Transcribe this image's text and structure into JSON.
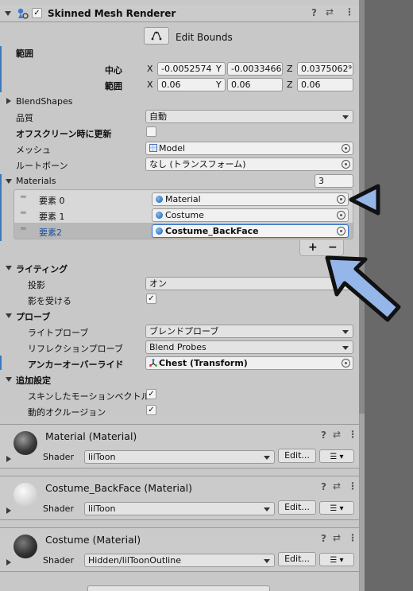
{
  "component": {
    "title": "Skinned Mesh Renderer",
    "icon": "skinned-mesh-icon",
    "enabled": true
  },
  "edit_bounds": {
    "label": "Edit Bounds"
  },
  "bounds": {
    "label": "範囲",
    "center_label": "中心",
    "center": {
      "x": "-0.0052574",
      "y": "-0.0033466",
      "z": "0.0375062⁹"
    },
    "extent_label": "範囲",
    "extent": {
      "x": "0.06",
      "y": "0.06",
      "z": "0.06"
    },
    "axis_x": "X",
    "axis_y": "Y",
    "axis_z": "Z"
  },
  "blendshapes": {
    "label": "BlendShapes"
  },
  "quality": {
    "label": "品質",
    "value": "自動"
  },
  "offscreen": {
    "label": "オフスクリーン時に更新",
    "checked": false
  },
  "mesh": {
    "label": "メッシュ",
    "value": "Model"
  },
  "root_bone": {
    "label": "ルートボーン",
    "value": "なし (トランスフォーム)"
  },
  "materials": {
    "label": "Materials",
    "count": "3",
    "items": [
      {
        "label": "要素 0",
        "value": "Material"
      },
      {
        "label": "要素 1",
        "value": "Costume"
      },
      {
        "label": "要素2",
        "value": "Costume_BackFace"
      }
    ],
    "add": "+",
    "remove": "−"
  },
  "lighting": {
    "label": "ライティング",
    "cast_shadows_label": "投影",
    "cast_shadows_value": "オン",
    "receive_shadows_label": "影を受ける",
    "receive_shadows": true
  },
  "probes": {
    "label": "プローブ",
    "light_probe_label": "ライトプローブ",
    "light_probe_value": "ブレンドプローブ",
    "reflection_label": "リフレクションプローブ",
    "reflection_value": "Blend Probes",
    "anchor_label": "アンカーオーバーライド",
    "anchor_value": "Chest (Transform)"
  },
  "additional": {
    "label": "追加設定",
    "motion_vectors_label": "スキンしたモーションベクトル",
    "motion_vectors": true,
    "occlusion_label": "動的オクルージョン",
    "occlusion": true
  },
  "material_blocks": [
    {
      "title": "Material (Material)",
      "shader_label": "Shader",
      "shader": "lilToon",
      "edit": "Edit...",
      "preview": "dark"
    },
    {
      "title": "Costume_BackFace (Material)",
      "shader_label": "Shader",
      "shader": "lilToon",
      "edit": "Edit...",
      "preview": "light"
    },
    {
      "title": "Costume (Material)",
      "shader_label": "Shader",
      "shader": "Hidden/lilToonOutline",
      "edit": "Edit...",
      "preview": "dark"
    }
  ],
  "icons": {
    "help": "?",
    "settings": "⇄",
    "more": "⋮",
    "menu": "☰"
  },
  "colors": {
    "accent_blue": "#3a79bb",
    "arrow_blue": "#94b6e8",
    "selected_row": "#b8b8b8"
  }
}
